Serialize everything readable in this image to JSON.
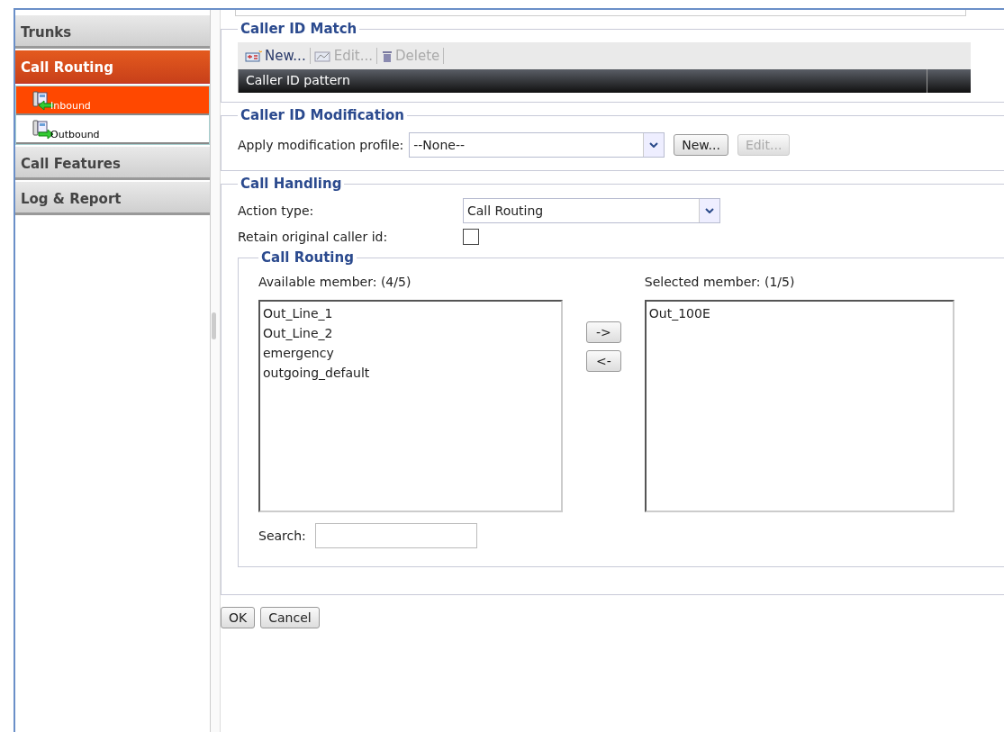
{
  "sidebar": {
    "items": [
      {
        "label": "Trunks",
        "selected": false
      },
      {
        "label": "Call Routing",
        "selected": true,
        "children": [
          {
            "label": "Inbound",
            "selected": true,
            "kind": "inbound"
          },
          {
            "label": "Outbound",
            "selected": false,
            "kind": "outbound"
          }
        ]
      },
      {
        "label": "Call Features",
        "selected": false
      },
      {
        "label": "Log & Report",
        "selected": false
      }
    ]
  },
  "caller_id_match": {
    "title": "Caller ID Match",
    "toolbar": [
      {
        "label": "New...",
        "kind": "new",
        "disabled": false
      },
      {
        "label": "Edit...",
        "kind": "edit",
        "disabled": true
      },
      {
        "label": "Delete",
        "kind": "delete",
        "disabled": true
      }
    ],
    "columns": [
      "Caller ID pattern"
    ]
  },
  "caller_id_modification": {
    "title": "Caller ID Modification",
    "label": "Apply modification profile:",
    "value": "--None--",
    "buttons": [
      {
        "label": "New...",
        "disabled": false
      },
      {
        "label": "Edit...",
        "disabled": true
      }
    ]
  },
  "call_handling": {
    "title": "Call Handling",
    "action_type_label": "Action type:",
    "action_type": "Call Routing",
    "retain_label": "Retain original caller id:",
    "retain_checked": false,
    "call_routing": {
      "title": "Call Routing",
      "available_label": "Available member: (4/5)",
      "available": [
        "Out_Line_1",
        "Out_Line_2",
        "emergency",
        "outgoing_default"
      ],
      "selected_label": "Selected member: (1/5)",
      "selected_members": [
        "Out_100E"
      ],
      "move_buttons": [
        "->",
        "<-"
      ],
      "search_label": "Search:"
    }
  },
  "buttons": [
    "OK",
    "Cancel"
  ]
}
